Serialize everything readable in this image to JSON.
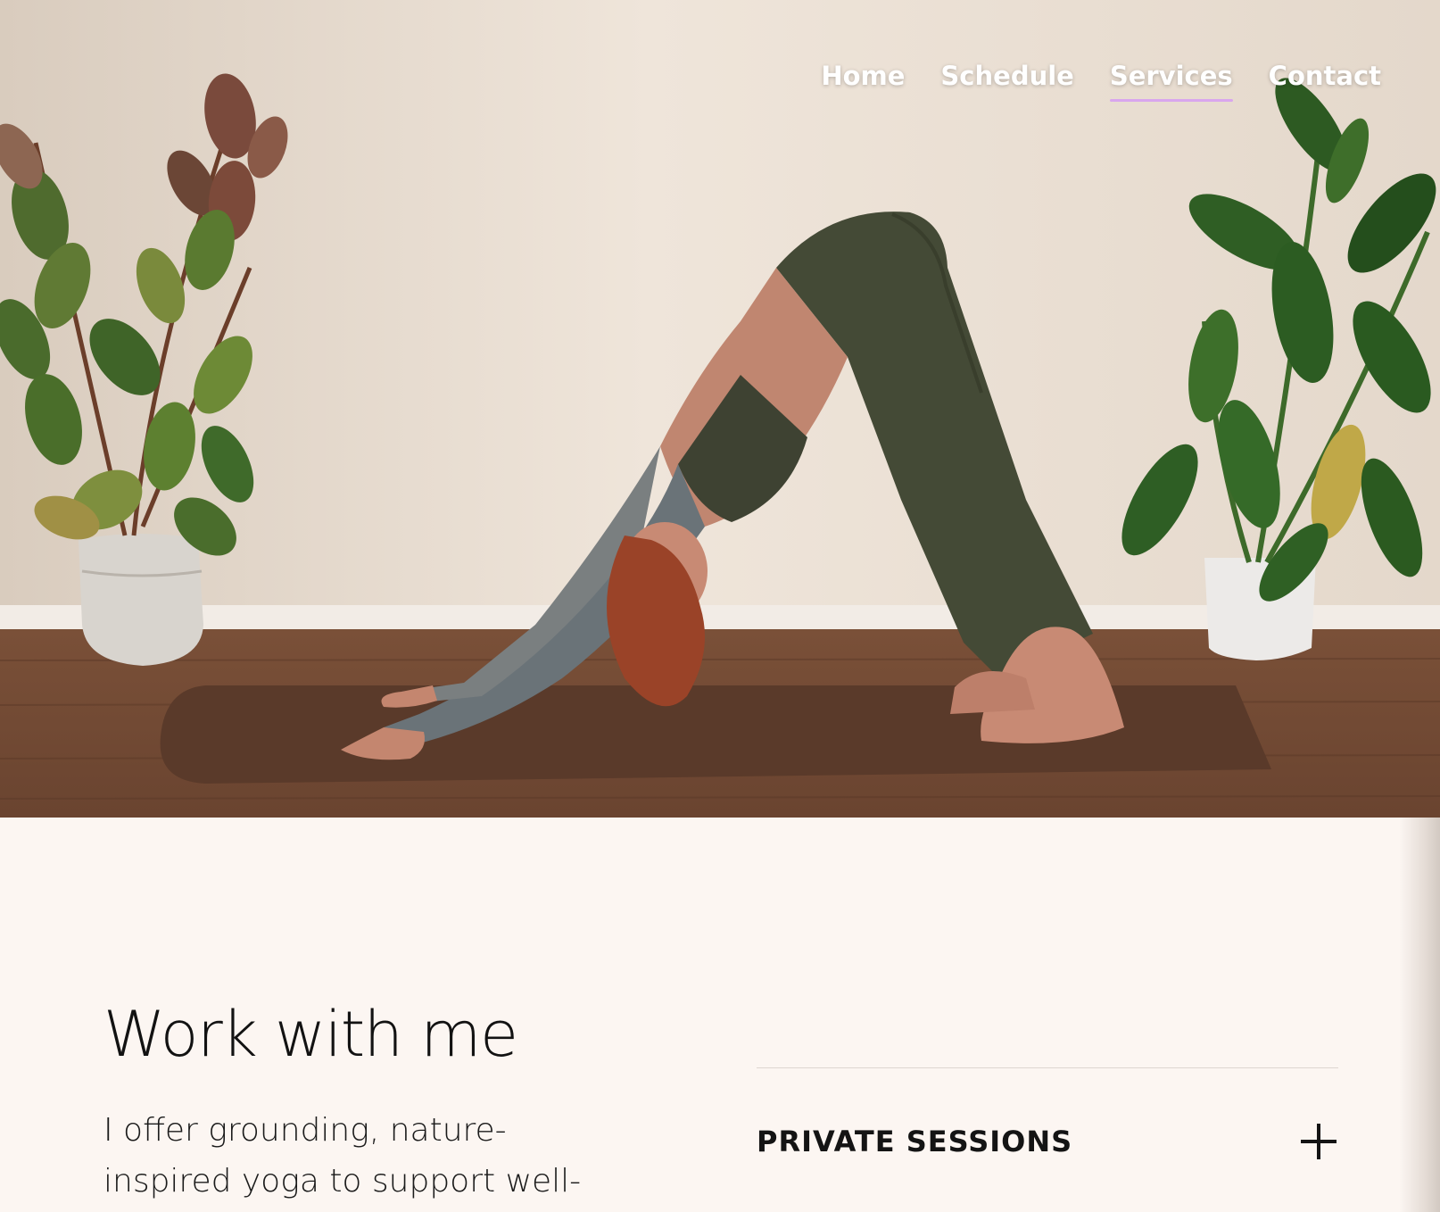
{
  "nav": {
    "items": [
      {
        "label": "Home",
        "active": false
      },
      {
        "label": "Schedule",
        "active": false
      },
      {
        "label": "Services",
        "active": true
      },
      {
        "label": "Contact",
        "active": false
      }
    ]
  },
  "main": {
    "heading": "Work with me",
    "intro": "I offer grounding, nature-inspired yoga to support well-"
  },
  "accordion": {
    "items": [
      {
        "title": "PRIVATE SESSIONS",
        "icon": "plus-icon"
      }
    ]
  },
  "colors": {
    "nav_text": "#ffffff",
    "nav_active_underline": "#d9a6ee",
    "page_background": "#fcf6f2",
    "text": "#121212"
  }
}
